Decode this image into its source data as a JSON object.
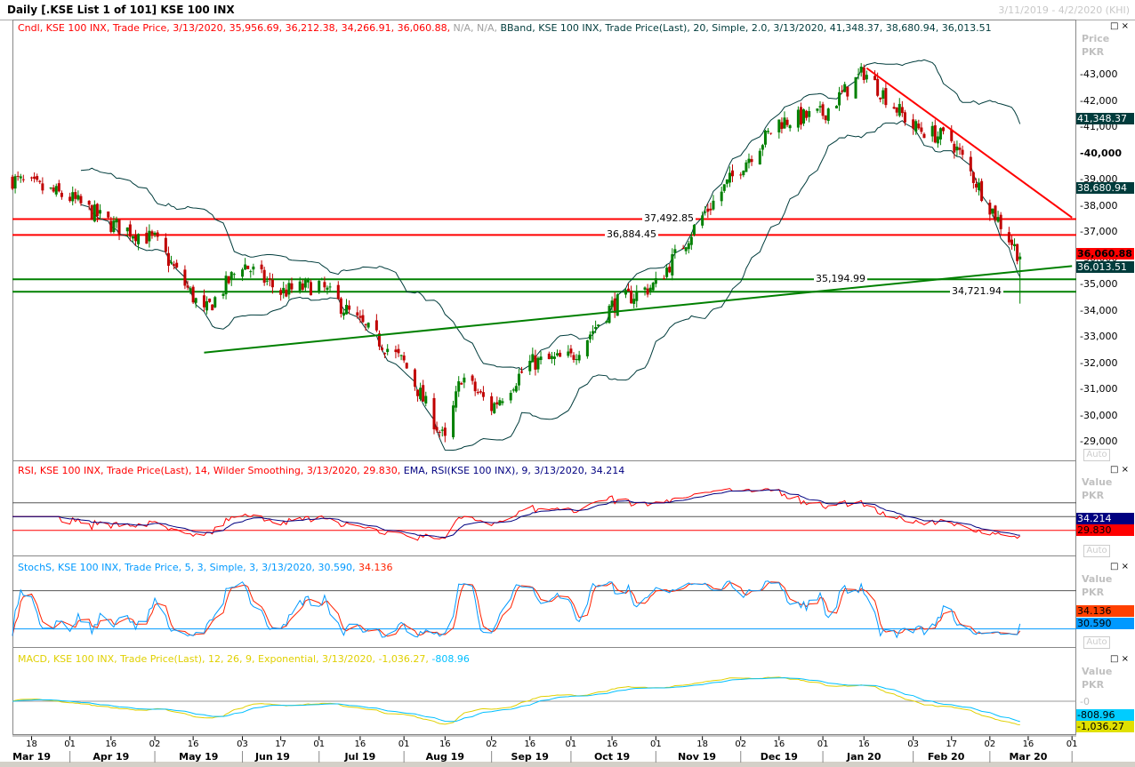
{
  "window": {
    "title": "Daily [.KSE List 1 of 101] KSE 100 INX",
    "date_range": "3/11/2019 - 4/2/2020 (KHI)"
  },
  "legends": {
    "price": [
      {
        "text": "Cndl, KSE 100 INX, Trade Price, 3/13/2020, 35,956.69, 36,212.38, 34,266.91, 36,060.88,",
        "color": "#ff0000"
      },
      {
        "text": " N/A, N/A,",
        "color": "#a0a0a0"
      },
      {
        "text": " BBand, KSE 100 INX, Trade Price(Last), 20, Simple, 2.0, 3/13/2020, 41,348.37, 38,680.94, 36,013.51",
        "color": "#003c3c"
      }
    ],
    "rsi": [
      {
        "text": "RSI, KSE 100 INX, Trade Price(Last), 14, Wilder Smoothing, 3/13/2020, 29.830,",
        "color": "#ff0000"
      },
      {
        "text": " EMA, RSI(KSE 100 INX), 9, 3/13/2020, 34.214",
        "color": "#000080"
      }
    ],
    "stoch": [
      {
        "text": "StochS, KSE 100 INX, Trade Price, 5, 3, Simple, 3, 3/13/2020, 30.590,",
        "color": "#0099ff"
      },
      {
        "text": " 34.136",
        "color": "#ff2200"
      }
    ],
    "macd": [
      {
        "text": "MACD, KSE 100 INX, Trade Price(Last), 12, 26, 9, Exponential, 3/13/2020, -1,036.27,",
        "color": "#e0d000"
      },
      {
        "text": " -808.96",
        "color": "#00bfff"
      }
    ]
  },
  "axes": {
    "price_unit": [
      "Price",
      "PKR"
    ],
    "value_unit": [
      "Value",
      "PKR"
    ],
    "auto_label": "Auto",
    "zero_label": "0",
    "price_ticks": [
      "43,000",
      "42,000",
      "41,000",
      "40,000",
      "39,000",
      "38,000",
      "37,000",
      "36,000",
      "35,000",
      "34,000",
      "33,000",
      "32,000",
      "31,000",
      "30,000",
      "29,000"
    ],
    "price_tick_values": [
      43000,
      42000,
      41000,
      40000,
      39000,
      38000,
      37000,
      36000,
      35000,
      34000,
      33000,
      32000,
      31000,
      30000,
      29000
    ],
    "price_tags": [
      {
        "text": "41,348.37",
        "value": 41348.37,
        "bg": "#003c3c",
        "fg": "#fff"
      },
      {
        "text": "38,680.94",
        "value": 38680.94,
        "bg": "#003c3c",
        "fg": "#fff"
      },
      {
        "text": "36,060.88",
        "value": 36200,
        "bg": "#ff0000",
        "fg": "#000"
      },
      {
        "text": "36,013.51",
        "value": 35680,
        "bg": "#003c3c",
        "fg": "#fff"
      }
    ],
    "rsi_tags": [
      {
        "text": "34.214",
        "bg": "#000080",
        "fg": "#fff"
      },
      {
        "text": "29.830",
        "bg": "#ff0000",
        "fg": "#000"
      }
    ],
    "stoch_tags": [
      {
        "text": "34.136",
        "bg": "#ff4000",
        "fg": "#000"
      },
      {
        "text": "30.590",
        "bg": "#0099ff",
        "fg": "#000"
      }
    ],
    "macd_tags": [
      {
        "text": "-808.96",
        "bg": "#00ccff",
        "fg": "#000"
      },
      {
        "text": "-1,036.27",
        "bg": "#e0e000",
        "fg": "#000"
      }
    ],
    "x_ticks": [
      {
        "d": "2019-03-18",
        "t": "18"
      },
      {
        "d": "2019-04-01",
        "t": "01"
      },
      {
        "d": "2019-04-16",
        "t": "16"
      },
      {
        "d": "2019-05-02",
        "t": "02"
      },
      {
        "d": "2019-05-16",
        "t": "16"
      },
      {
        "d": "2019-06-03",
        "t": "03"
      },
      {
        "d": "2019-06-17",
        "t": "17"
      },
      {
        "d": "2019-07-01",
        "t": "01"
      },
      {
        "d": "2019-07-16",
        "t": "16"
      },
      {
        "d": "2019-08-01",
        "t": "01"
      },
      {
        "d": "2019-08-16",
        "t": "16"
      },
      {
        "d": "2019-09-02",
        "t": "02"
      },
      {
        "d": "2019-09-16",
        "t": "16"
      },
      {
        "d": "2019-10-01",
        "t": "01"
      },
      {
        "d": "2019-10-16",
        "t": "16"
      },
      {
        "d": "2019-11-01",
        "t": "01"
      },
      {
        "d": "2019-11-18",
        "t": "18"
      },
      {
        "d": "2019-12-02",
        "t": "02"
      },
      {
        "d": "2019-12-16",
        "t": "16"
      },
      {
        "d": "2020-01-01",
        "t": "01"
      },
      {
        "d": "2020-01-16",
        "t": "16"
      },
      {
        "d": "2020-02-03",
        "t": "03"
      },
      {
        "d": "2020-02-17",
        "t": "17"
      },
      {
        "d": "2020-03-02",
        "t": "02"
      },
      {
        "d": "2020-03-16",
        "t": "16"
      },
      {
        "d": "2020-04-01",
        "t": "01"
      }
    ],
    "months": [
      {
        "d": "2019-03-18",
        "t": "Mar 19"
      },
      {
        "d": "2019-04-16",
        "t": "Apr 19"
      },
      {
        "d": "2019-05-18",
        "t": "May 19"
      },
      {
        "d": "2019-06-14",
        "t": "Jun 19"
      },
      {
        "d": "2019-07-16",
        "t": "Jul 19"
      },
      {
        "d": "2019-08-16",
        "t": "Aug 19"
      },
      {
        "d": "2019-09-16",
        "t": "Sep 19"
      },
      {
        "d": "2019-10-16",
        "t": "Oct 19"
      },
      {
        "d": "2019-11-16",
        "t": "Nov 19"
      },
      {
        "d": "2019-12-16",
        "t": "Dec 19"
      },
      {
        "d": "2020-01-16",
        "t": "Jan 20"
      },
      {
        "d": "2020-02-15",
        "t": "Feb 20"
      },
      {
        "d": "2020-03-16",
        "t": "Mar 20"
      }
    ]
  },
  "chart_data": {
    "type": "candlestick",
    "title": "Daily [.KSE List 1 of 101] KSE 100 INX",
    "xlim": [
      "2019-03-11",
      "2020-04-01"
    ],
    "ylim": [
      28500,
      45000
    ],
    "close_keypoints": [
      [
        "2019-03-11",
        39000
      ],
      [
        "2019-04-01",
        38300
      ],
      [
        "2019-04-16",
        37300
      ],
      [
        "2019-05-02",
        36700
      ],
      [
        "2019-05-20",
        33900
      ],
      [
        "2019-06-03",
        35800
      ],
      [
        "2019-06-17",
        34700
      ],
      [
        "2019-07-01",
        35000
      ],
      [
        "2019-07-16",
        33500
      ],
      [
        "2019-08-01",
        32000
      ],
      [
        "2019-08-16",
        29000
      ],
      [
        "2019-08-22",
        31500
      ],
      [
        "2019-09-02",
        30300
      ],
      [
        "2019-09-16",
        32000
      ],
      [
        "2019-10-01",
        32200
      ],
      [
        "2019-10-16",
        34200
      ],
      [
        "2019-11-01",
        35000
      ],
      [
        "2019-11-18",
        37600
      ],
      [
        "2019-12-02",
        39500
      ],
      [
        "2019-12-16",
        41200
      ],
      [
        "2020-01-01",
        41500
      ],
      [
        "2020-01-16",
        43100
      ],
      [
        "2020-02-03",
        41000
      ],
      [
        "2020-02-17",
        40500
      ],
      [
        "2020-03-02",
        38000
      ],
      [
        "2020-03-13",
        36060.88
      ]
    ],
    "last_candle": {
      "date": "3/13/2020",
      "open": 35956.69,
      "high": 36212.38,
      "low": 34266.91,
      "close": 36060.88
    },
    "bollinger_last": {
      "upper": 41348.37,
      "middle": 38680.94,
      "lower": 36013.51
    },
    "horizontal_levels": [
      {
        "value": 37492.85,
        "label": "37,492.85",
        "color": "#ff0000"
      },
      {
        "value": 36884.45,
        "label": "36,884.45",
        "color": "#ff0000"
      },
      {
        "value": 35194.99,
        "label": "35,194.99",
        "color": "#008000"
      },
      {
        "value": 34721.94,
        "label": "34,721.94",
        "color": "#008000"
      }
    ],
    "trendlines": [
      {
        "from": [
          "2019-05-20",
          32400
        ],
        "to": [
          "2020-04-01",
          35700
        ],
        "color": "#008000"
      },
      {
        "from": [
          "2020-01-17",
          43250
        ],
        "to": [
          "2020-04-01",
          37550
        ],
        "color": "#ff0000"
      }
    ],
    "rsi": {
      "period": 14,
      "last": 29.83,
      "ema_last": 34.214,
      "levels": [
        70,
        50,
        30
      ]
    },
    "stoch": {
      "k": 5,
      "d": 3,
      "last_k": 30.59,
      "last_d": 34.136,
      "levels": [
        80,
        20
      ]
    },
    "macd": {
      "fast": 12,
      "slow": 26,
      "signal": 9,
      "last": -1036.27,
      "signal_last": -808.96
    }
  }
}
